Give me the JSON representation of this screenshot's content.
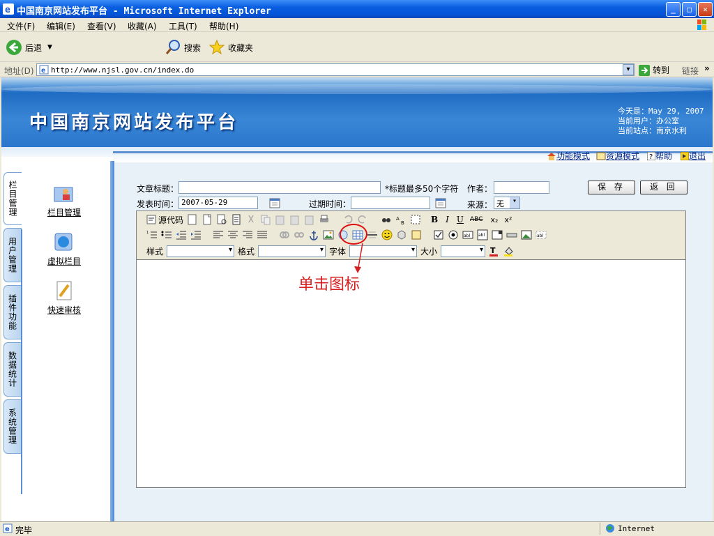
{
  "window": {
    "title": "中国南京网站发布平台 - Microsoft Internet Explorer",
    "min": "_",
    "max": "□",
    "close": "✕"
  },
  "menu": [
    "文件(F)",
    "编辑(E)",
    "查看(V)",
    "收藏(A)",
    "工具(T)",
    "帮助(H)"
  ],
  "toolbar": {
    "back": "后退",
    "search": "搜索",
    "favorites": "收藏夹"
  },
  "address": {
    "label": "地址(D)",
    "url": "http://www.njsl.gov.cn/index.do",
    "go": "转到",
    "links": "链接"
  },
  "header": {
    "title": "中国南京网站发布平台",
    "date_line": "今天是：May 29, 2007",
    "user_line": "当前用户：办公室",
    "site_line": "当前站点：南京水利"
  },
  "nav": {
    "function_mode": "功能模式",
    "resource_mode": "资源模式",
    "help": "帮助",
    "logout": "退出"
  },
  "sidebar": {
    "tabs": [
      "栏目管理",
      "用户管理",
      "插件功能",
      "数据统计",
      "系统管理"
    ],
    "items": [
      "栏目管理",
      "虚拟栏目",
      "快速审核"
    ]
  },
  "form": {
    "title_label": "文章标题：",
    "title_hint": "*标题最多50个字符",
    "author_label": "作者：",
    "publish_label": "发表时间：",
    "publish_value": "2007-05-29",
    "expire_label": "过期时间：",
    "source_label": "来源：",
    "source_value": "无",
    "save": "保 存",
    "back": "返 回"
  },
  "editor": {
    "source_code": "源代码",
    "style_label": "样式",
    "format_label": "格式",
    "font_label": "字体",
    "size_label": "大小",
    "sub": "x₂",
    "sup": "x²"
  },
  "annotation": "单击图标",
  "status": {
    "text": "完毕",
    "zone": "Internet"
  }
}
